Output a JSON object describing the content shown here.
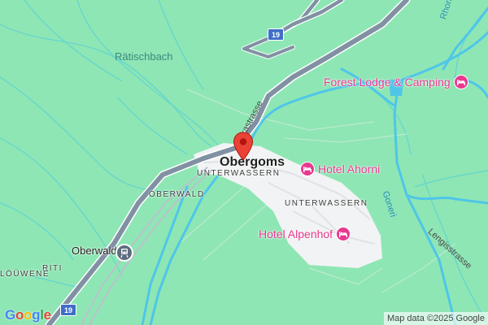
{
  "map": {
    "places": {
      "obergoms": "Obergoms",
      "unterwassern_1": "UNTERWASSERN",
      "unterwassern_2": "UNTERWASSERN",
      "oberwald_area": "OBERWALD",
      "oberwald": "Oberwald",
      "riti": "RITI",
      "louwene": "LÖÜWENE"
    },
    "water": {
      "ratischbach": "Rätischbach",
      "rhone": "Rhone",
      "goneri": "Goneri"
    },
    "roads": {
      "furkastrasse": "kastrasse",
      "lengisstrasse": "Lengisstrasse",
      "route_shield_top": "19",
      "route_shield_bottom": "19"
    },
    "pois": [
      {
        "label": "Forest Lodge & Camping",
        "icon": "hotel-icon"
      },
      {
        "label": "Hotel Ahorni",
        "icon": "hotel-icon"
      },
      {
        "label": "Hotel Alpenhof",
        "icon": "hotel-icon"
      }
    ],
    "station_icon": "train-station-icon",
    "marker_icon": "location-pin-icon",
    "logo": "Google",
    "attribution": "Map data ©2025 Google",
    "colors": {
      "land": "#8ee6b4",
      "river": "#4fc6e8",
      "highway": "#8191a3",
      "poi": "#e8388f",
      "marker": "#ea4335"
    }
  }
}
